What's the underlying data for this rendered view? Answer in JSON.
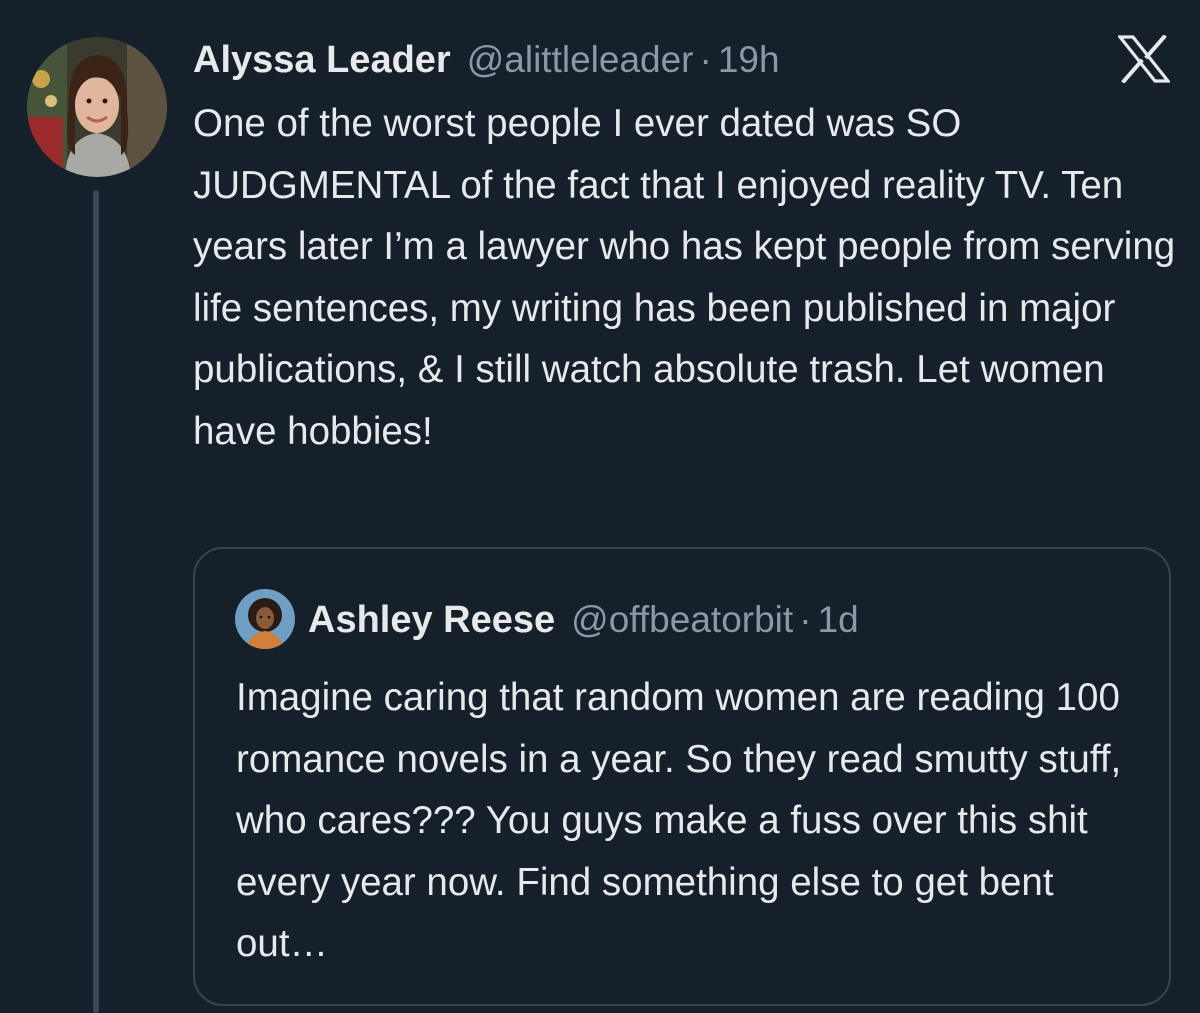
{
  "tweet": {
    "author": {
      "name": "Alyssa Leader",
      "handle": "@alittleleader",
      "separator": "·",
      "time": "19h"
    },
    "text": "One of the worst people I ever dated was SO JUDGMENTAL of the fact that I enjoyed reality TV. Ten years later I’m a lawyer who has kept people from serving life sentences, my writing has been published in major publications, & I still watch absolute trash. Let women have hobbies!",
    "platform_icon": "x-logo-icon"
  },
  "quote": {
    "author": {
      "name": "Ashley Reese",
      "handle": "@offbeatorbit",
      "separator": "·",
      "time": "1d"
    },
    "text": "Imagine caring that random women are reading 100 romance novels in a year. So they read smutty stuff, who cares??? You guys make a fuss over this shit every year now. Find something else to get bent out…"
  },
  "colors": {
    "background": "#15202b",
    "text_primary": "#e7e9ea",
    "text_secondary": "#8b98a5",
    "border": "#38444d",
    "thread_line": "#3a4856"
  }
}
